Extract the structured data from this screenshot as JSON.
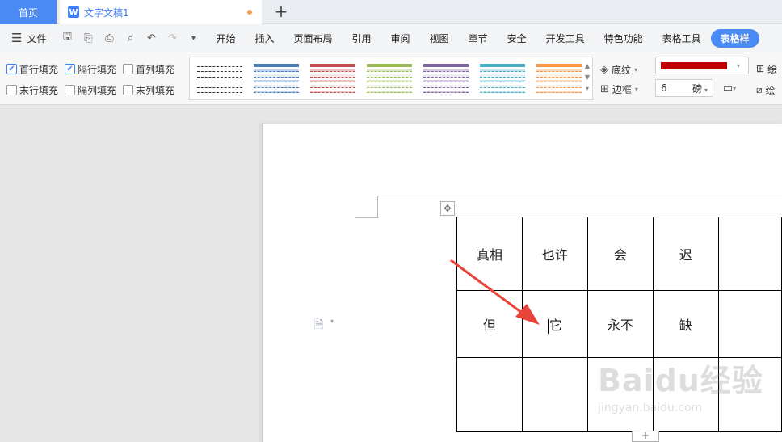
{
  "tabs": {
    "home_label": "首页",
    "doc_icon_letter": "W",
    "doc_title": "文字文稿1",
    "add_symbol": "+"
  },
  "menubar": {
    "file_label": "文件",
    "items": [
      "开始",
      "插入",
      "页面布局",
      "引用",
      "审阅",
      "视图",
      "章节",
      "安全",
      "开发工具",
      "特色功能",
      "表格工具",
      "表格样式"
    ],
    "active_item": "表格样"
  },
  "ribbon": {
    "checkboxes": [
      {
        "label": "首行填充",
        "checked": true
      },
      {
        "label": "隔行填充",
        "checked": true
      },
      {
        "label": "首列填充",
        "checked": false
      },
      {
        "label": "末行填充",
        "checked": false
      },
      {
        "label": "隔列填充",
        "checked": false
      },
      {
        "label": "末列填充",
        "checked": false
      }
    ],
    "shading_label": "底纹",
    "border_label": "边框",
    "pen_color": "#c00000",
    "pen_size": "6",
    "pen_unit": "磅",
    "draw_label_1": "绘",
    "draw_label_2": "绘",
    "style_colors": [
      "#666666",
      "#4a7ebb",
      "#c0504d",
      "#9bbb59",
      "#8064a2",
      "#4bacc6",
      "#f79646"
    ]
  },
  "table": {
    "rows": [
      [
        "真相",
        "也许",
        "会",
        "迟",
        ""
      ],
      [
        "但",
        "它",
        "永不",
        "缺",
        ""
      ],
      [
        "",
        "",
        "",
        "",
        ""
      ]
    ]
  },
  "colors": {
    "accent": "#4a8af4",
    "arrow": "#e8443a"
  },
  "watermark": {
    "text": "Baidu经验",
    "url": "jingyan.baidu.com"
  }
}
